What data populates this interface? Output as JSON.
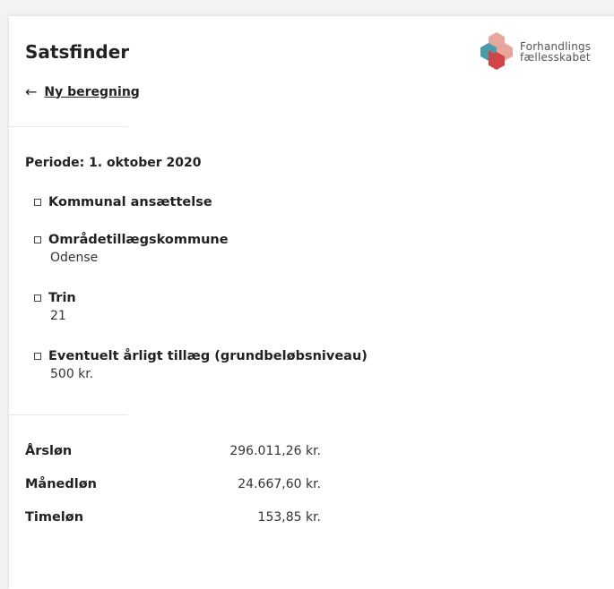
{
  "header": {
    "title": "Satsfinder",
    "back_link": "Ny beregning",
    "logo": {
      "line1": "Forhandlings",
      "line2": "fællesskabet"
    }
  },
  "period": "Periode: 1. oktober 2020",
  "items": [
    {
      "label": "Kommunal ansættelse",
      "value": ""
    },
    {
      "label": "Områdetillægskommune",
      "value": "Odense"
    },
    {
      "label": "Trin",
      "value": "21"
    },
    {
      "label": "Eventuelt årligt tillæg (grundbeløbsniveau)",
      "value": "500 kr."
    }
  ],
  "results": [
    {
      "label": "Årsløn",
      "value": "296.011,26 kr."
    },
    {
      "label": "Månedløn",
      "value": "24.667,60 kr."
    },
    {
      "label": "Timeløn",
      "value": "153,85 kr."
    }
  ],
  "colors": {
    "logo_teal": "#4a9aa7",
    "logo_pink": "#e8a79c",
    "logo_red": "#d64545"
  },
  "icons": {
    "back": "arrow-left-icon",
    "logo": "hexagon-cluster-logo",
    "bullet": "checkbox-icon"
  }
}
